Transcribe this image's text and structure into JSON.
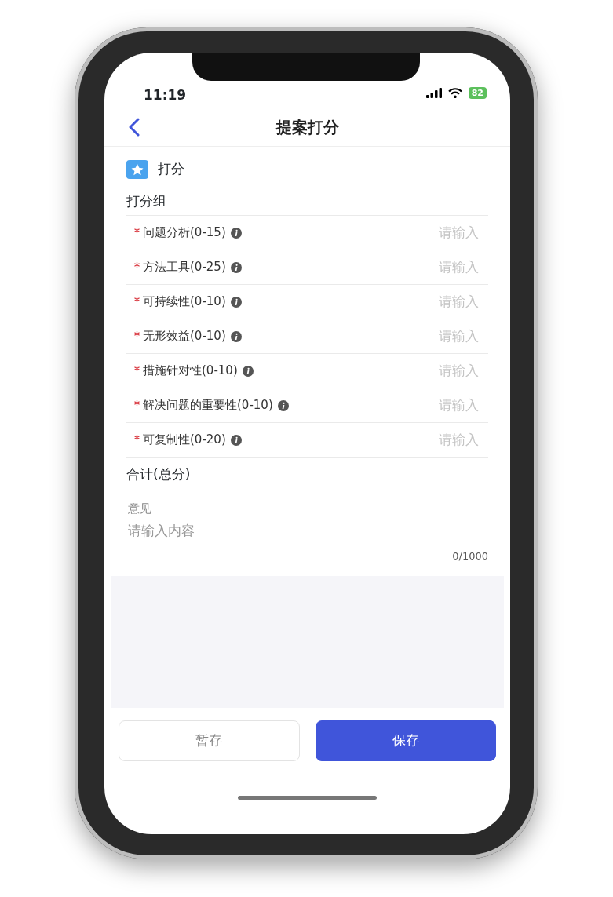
{
  "status_bar": {
    "time": "11:19",
    "battery": "82"
  },
  "nav": {
    "title": "提案打分"
  },
  "section": {
    "title": "打分"
  },
  "group": {
    "title": "打分组"
  },
  "fields": [
    {
      "label": "问题分析(0-15)",
      "required": true,
      "placeholder": "请输入"
    },
    {
      "label": "方法工具(0-25)",
      "required": true,
      "placeholder": "请输入"
    },
    {
      "label": "可持续性(0-10)",
      "required": true,
      "placeholder": "请输入"
    },
    {
      "label": "无形效益(0-10)",
      "required": true,
      "placeholder": "请输入"
    },
    {
      "label": "措施针对性(0-10)",
      "required": true,
      "placeholder": "请输入"
    },
    {
      "label": "解决问题的重要性(0-10)",
      "required": true,
      "placeholder": "请输入"
    },
    {
      "label": "可复制性(0-20)",
      "required": true,
      "placeholder": "请输入"
    }
  ],
  "total": {
    "label": "合计(总分)"
  },
  "comment": {
    "label": "意见",
    "placeholder": "请输入内容",
    "counter": "0/1000"
  },
  "buttons": [
    {
      "label": "暂存",
      "kind": "secondary"
    },
    {
      "label": "保存",
      "kind": "primary"
    }
  ]
}
